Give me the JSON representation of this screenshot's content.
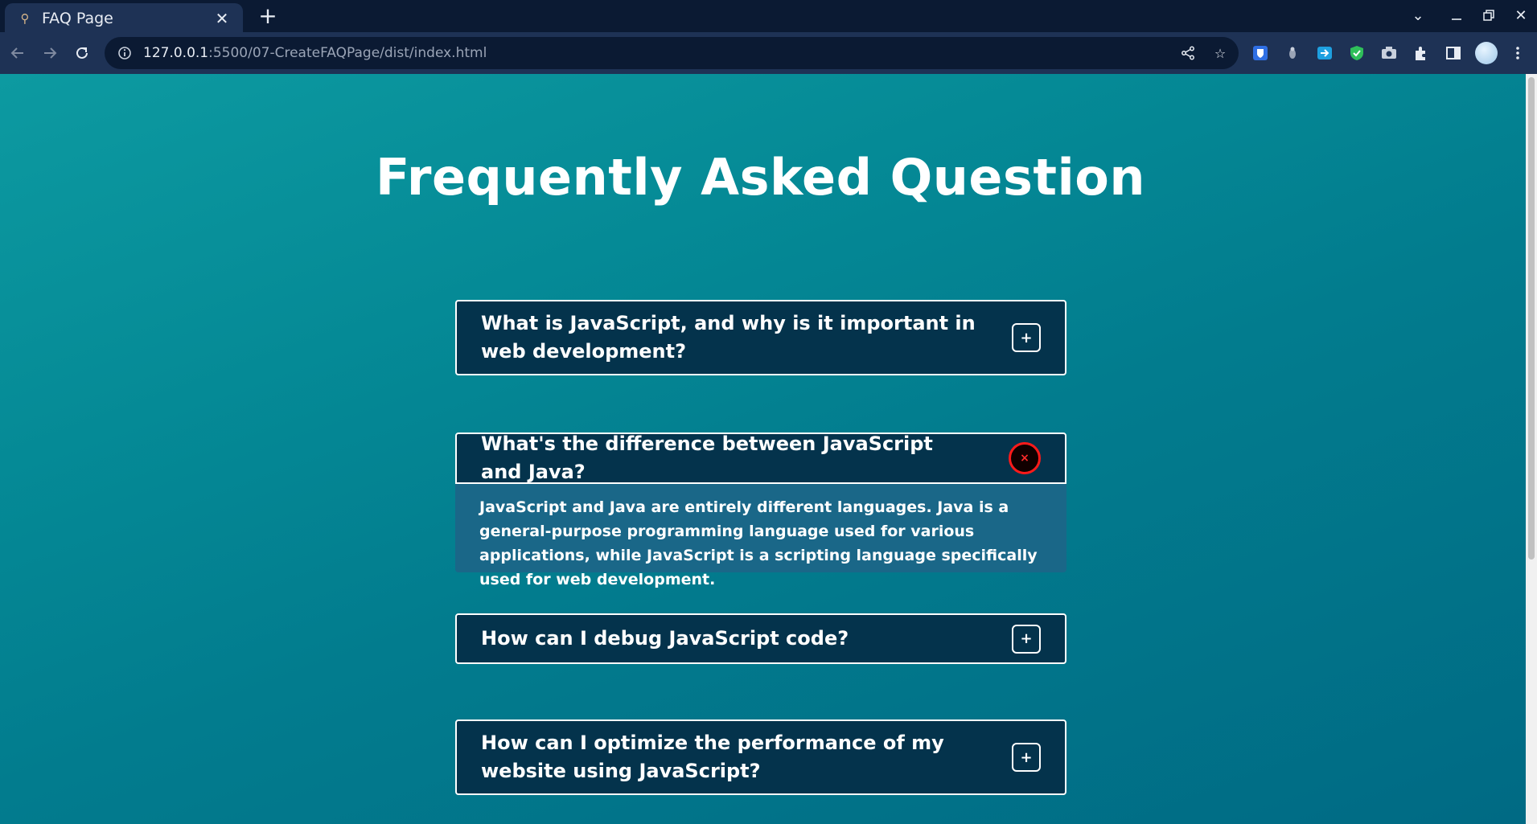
{
  "browser": {
    "tab_title": "FAQ Page",
    "url_host": "127.0.0.1",
    "url_path": ":5500/07-CreateFAQPage/dist/index.html"
  },
  "page": {
    "title": "Frequently Asked Question"
  },
  "faqs": [
    {
      "question": "What is JavaScript, and why is it important in web development?",
      "toggle": "+",
      "expanded": false
    },
    {
      "question": "What's the difference between JavaScript and Java?",
      "toggle": "×",
      "expanded": true,
      "answer": "JavaScript and Java are entirely different languages. Java is a general-purpose programming language used for various applications, while JavaScript is a scripting language specifically used for web development."
    },
    {
      "question": "How can I debug JavaScript code?",
      "toggle": "+",
      "expanded": false
    },
    {
      "question": "How can I optimize the performance of my website using JavaScript?",
      "toggle": "+",
      "expanded": false
    }
  ],
  "colors": {
    "question_bg": "#04334c",
    "answer_bg": "#1a6788",
    "close_ring": "#ff1a1a"
  }
}
